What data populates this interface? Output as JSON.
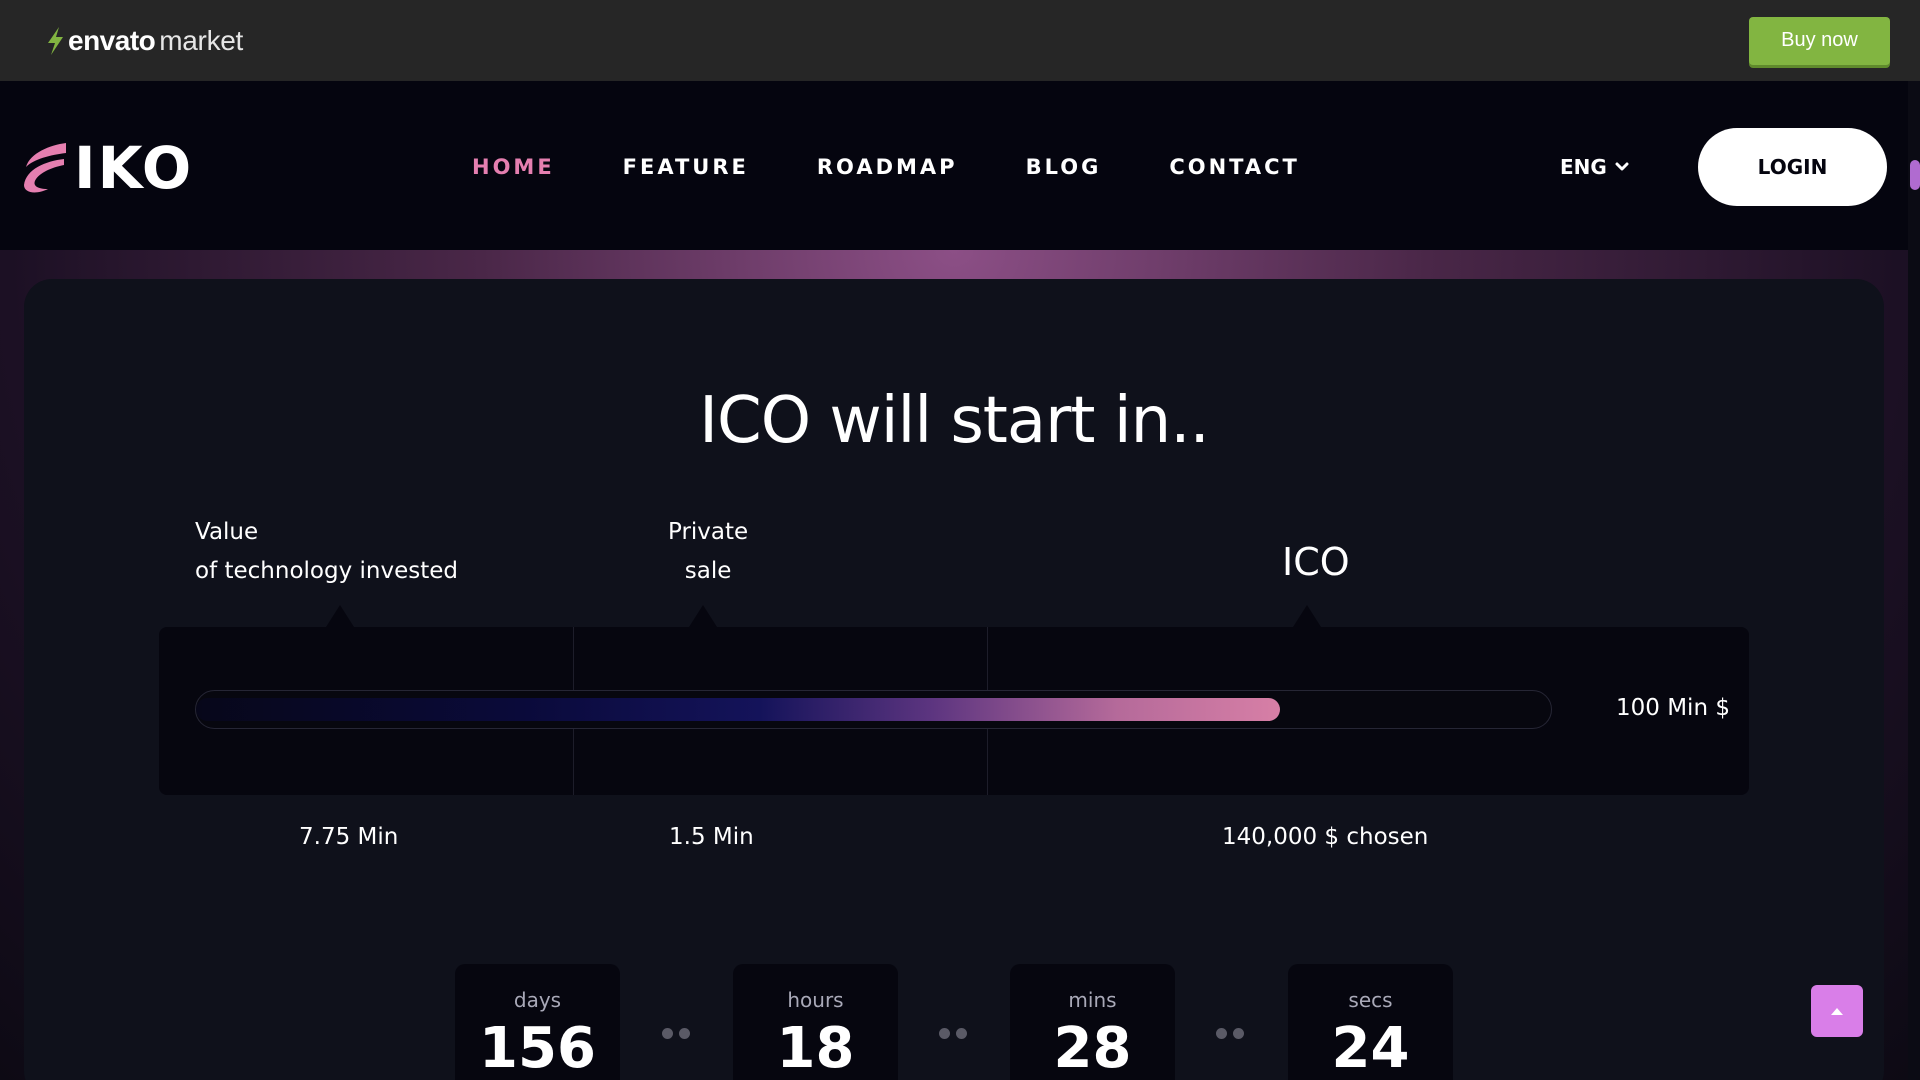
{
  "envato": {
    "brand": "envato",
    "suffix": "market",
    "buy_now": "Buy now"
  },
  "header": {
    "logo": "IKO",
    "nav": [
      "HOME",
      "FEATURE",
      "ROADMAP",
      "BLOG",
      "CONTACT"
    ],
    "active_nav": "HOME",
    "language": "ENG",
    "login": "LOGIN"
  },
  "ico": {
    "title": "ICO will start in..",
    "stages": [
      {
        "label_line1": "Value",
        "label_line2": "of technology invested",
        "amount": "7.75 Min"
      },
      {
        "label_line1": "Private",
        "label_line2": "sale",
        "amount": "1.5 Min"
      },
      {
        "label_line1": "ICO",
        "label_line2": "",
        "amount": "140,000 $ chosen"
      }
    ],
    "progress_max_label": "100 Min $",
    "progress_percent": 80
  },
  "countdown": [
    {
      "unit": "days",
      "value": "156"
    },
    {
      "unit": "hours",
      "value": "18"
    },
    {
      "unit": "mins",
      "value": "28"
    },
    {
      "unit": "secs",
      "value": "24"
    }
  ],
  "colors": {
    "accent_pink": "#e57fb0",
    "envato_green": "#82b541",
    "back_to_top": "#d97ee8",
    "background": "#05050f",
    "card": "#0f111b"
  },
  "icons": [
    "envato-leaf-icon",
    "iko-logo-mark-icon",
    "chevron-down-icon",
    "arrow-up-icon"
  ]
}
